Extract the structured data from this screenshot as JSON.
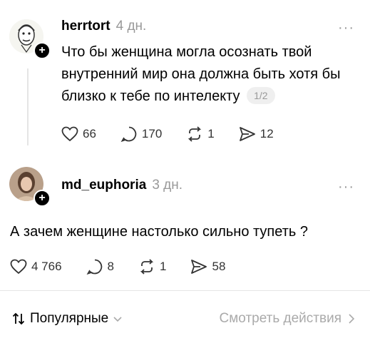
{
  "posts": [
    {
      "username": "herrtort",
      "time": "4 дн.",
      "more": "···",
      "text": "Что бы женщина могла осознать твой внутренний мир она должна быть хотя бы близко к тебе по интелекту",
      "page_indicator": "1/2",
      "likes": "66",
      "replies": "170",
      "reposts": "1",
      "shares": "12"
    },
    {
      "username": "md_euphoria",
      "time": "3 дн.",
      "more": "···",
      "text": "А зачем женщине настолько сильно тупеть ?",
      "likes": "4 766",
      "replies": "8",
      "reposts": "1",
      "shares": "58"
    }
  ],
  "footer": {
    "sort_label": "Популярные",
    "view_activity_label": "Смотреть действия"
  },
  "colors": {
    "muted": "#999999",
    "divider": "#e5e5e5",
    "text": "#000000"
  },
  "icons": [
    "heart-icon",
    "comment-icon",
    "repost-icon",
    "share-icon",
    "sort-icon",
    "chevron-down-icon",
    "chevron-right-icon"
  ]
}
